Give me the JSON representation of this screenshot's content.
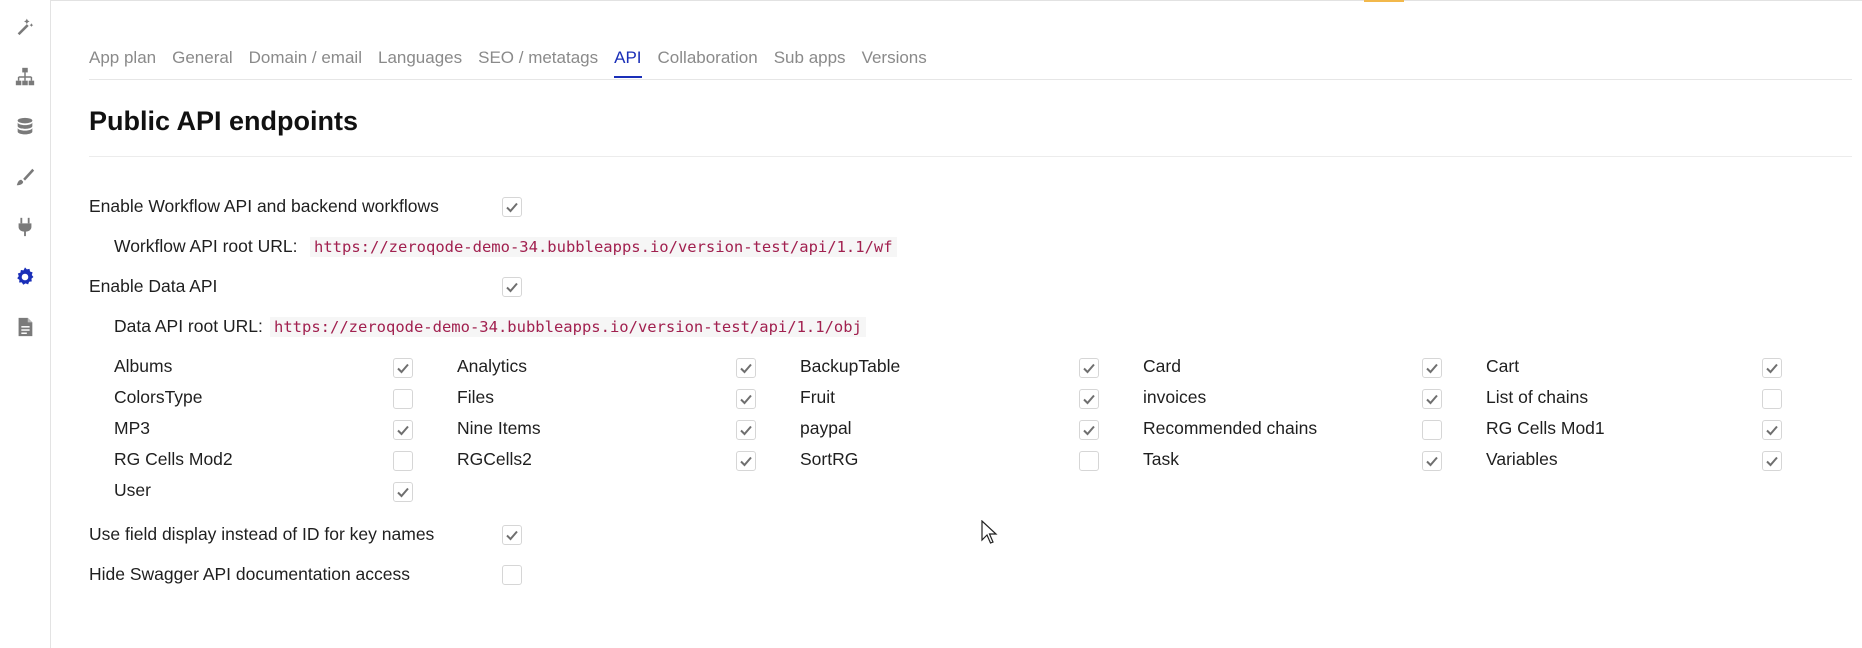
{
  "colors": {
    "accent": "#1a2fb8",
    "url_text": "#a1204f",
    "check": "#6f6f6f",
    "muted": "#8a8a8a"
  },
  "sidebar": {
    "items": [
      {
        "icon": "design-icon",
        "active": false
      },
      {
        "icon": "workflow-icon",
        "active": false
      },
      {
        "icon": "data-icon",
        "active": false
      },
      {
        "icon": "styles-icon",
        "active": false
      },
      {
        "icon": "plugins-icon",
        "active": false
      },
      {
        "icon": "settings-icon",
        "active": true
      },
      {
        "icon": "logs-icon",
        "active": false
      }
    ]
  },
  "tabs": [
    {
      "label": "App plan"
    },
    {
      "label": "General"
    },
    {
      "label": "Domain / email"
    },
    {
      "label": "Languages"
    },
    {
      "label": "SEO / metatags"
    },
    {
      "label": "API",
      "active": true
    },
    {
      "label": "Collaboration"
    },
    {
      "label": "Sub apps"
    },
    {
      "label": "Versions"
    }
  ],
  "page": {
    "title": "Public API endpoints"
  },
  "settings": {
    "workflow_api": {
      "label": "Enable Workflow API and backend workflows",
      "checked": true
    },
    "workflow_url": {
      "label": "Workflow API root URL:",
      "value": "https://zeroqode-demo-34.bubbleapps.io/version-test/api/1.1/wf"
    },
    "data_api": {
      "label": "Enable Data API",
      "checked": true
    },
    "data_url": {
      "label": "Data API root URL:",
      "value": "https://zeroqode-demo-34.bubbleapps.io/version-test/api/1.1/obj"
    },
    "field_display": {
      "label": "Use field display instead of ID for key names",
      "checked": true
    },
    "hide_swagger": {
      "label": "Hide Swagger API documentation access",
      "checked": false
    }
  },
  "data_types": [
    {
      "name": "Albums",
      "checked": true
    },
    {
      "name": "Analytics",
      "checked": true
    },
    {
      "name": "BackupTable",
      "checked": true
    },
    {
      "name": "Card",
      "checked": true
    },
    {
      "name": "Cart",
      "checked": true
    },
    {
      "name": "ColorsType",
      "checked": false
    },
    {
      "name": "Files",
      "checked": true
    },
    {
      "name": "Fruit",
      "checked": true
    },
    {
      "name": "invoices",
      "checked": true
    },
    {
      "name": "List of chains",
      "checked": false
    },
    {
      "name": "MP3",
      "checked": true
    },
    {
      "name": "Nine Items",
      "checked": true
    },
    {
      "name": "paypal",
      "checked": true
    },
    {
      "name": "Recommended chains",
      "checked": false
    },
    {
      "name": "RG Cells Mod1",
      "checked": true
    },
    {
      "name": "RG Cells Mod2",
      "checked": false
    },
    {
      "name": "RGCells2",
      "checked": true
    },
    {
      "name": "SortRG",
      "checked": false
    },
    {
      "name": "Task",
      "checked": true
    },
    {
      "name": "Variables",
      "checked": true
    },
    {
      "name": "User",
      "checked": true
    }
  ]
}
